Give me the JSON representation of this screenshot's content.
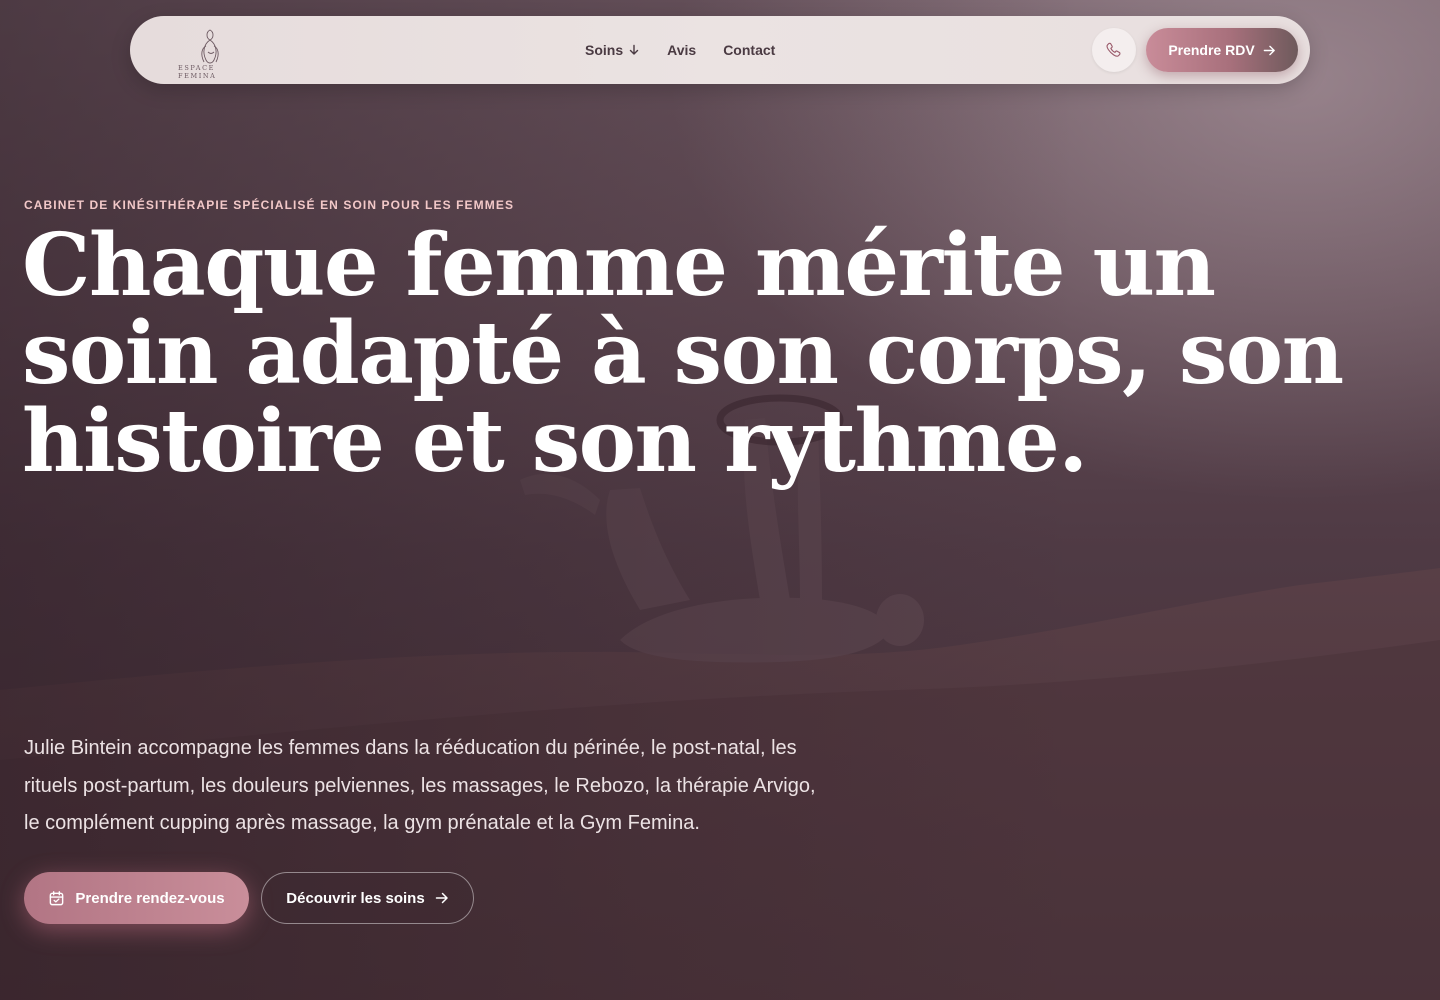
{
  "nav": {
    "logo_text": "ESPACE FEMINA",
    "links": [
      {
        "label": "Soins",
        "icon": "arrow-down-icon"
      },
      {
        "label": "Avis"
      },
      {
        "label": "Contact"
      }
    ],
    "phone_icon": "phone-icon",
    "cta_label": "Prendre RDV",
    "cta_icon": "arrow-right-icon"
  },
  "hero": {
    "eyebrow": "CABINET DE KINÉSITHÉRAPIE SPÉCIALISÉ EN SOIN POUR LES FEMMES",
    "headline_lines": [
      "Chaque femme mérite un",
      "soin adapté à son corps, son",
      "histoire et son rythme."
    ],
    "lead_lines": [
      "Julie Bintein accompagne les femmes dans la rééducation du périnée, le post-natal, les",
      "rituels post-partum, les douleurs pelviennes, les massages, le Rebozo, la thérapie Arvigo,",
      "le complément cupping après massage, la gym prénatale et la Gym Femina."
    ],
    "primary_button": {
      "label": "Prendre rendez-vous",
      "icon": "calendar-icon"
    },
    "secondary_button": {
      "label": "Découvrir les soins",
      "icon": "arrow-right-icon"
    }
  },
  "colors": {
    "accent": "#c98c99",
    "eyebrow": "#f2c8c8",
    "headline": "#ffffff",
    "nav_bg": "#e8dfdf"
  }
}
